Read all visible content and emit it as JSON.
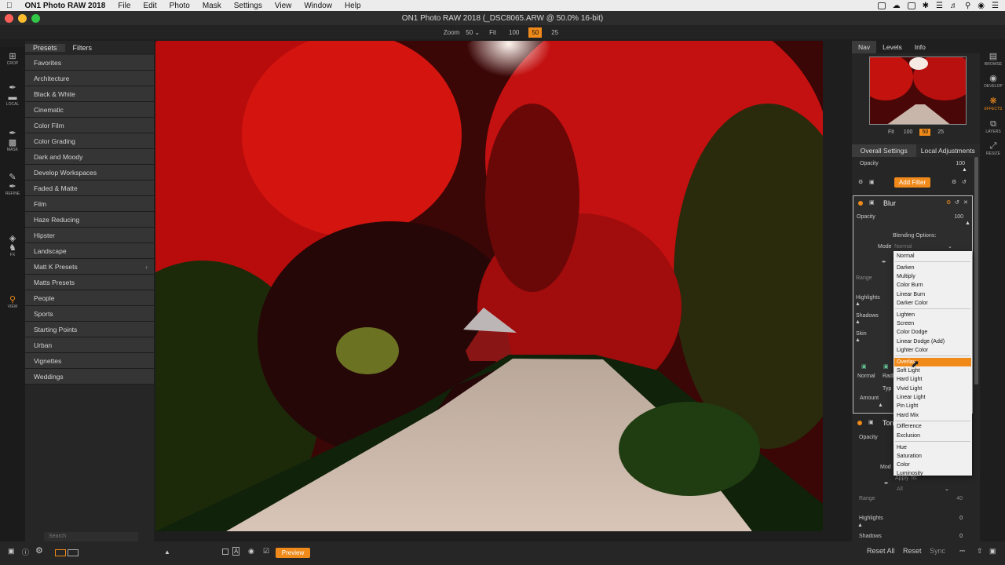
{
  "menubar": {
    "app": "ON1 Photo RAW 2018",
    "items": [
      "File",
      "Edit",
      "Photo",
      "Mask",
      "Settings",
      "View",
      "Window",
      "Help"
    ]
  },
  "window_title": "ON1 Photo RAW 2018 (_DSC8065.ARW @ 50.0% 16-bit)",
  "toolbar": {
    "zoom_label": "Zoom",
    "zoom_value": "50",
    "fit": "Fit",
    "z100": "100",
    "z50": "50",
    "z25": "25"
  },
  "left_tools": [
    "CROP",
    "LOCAL",
    "MASK",
    "REFINE",
    "FX",
    "VIEW"
  ],
  "presets": {
    "tab_presets": "Presets",
    "tab_filters": "Filters",
    "items": [
      "Favorites",
      "Architecture",
      "Black & White",
      "Cinematic",
      "Color Film",
      "Color Grading",
      "Dark and Moody",
      "Develop Workspaces",
      "Faded & Matte",
      "Film",
      "Haze Reducing",
      "Hipster",
      "Landscape",
      "Matt K Presets",
      "Matts Presets",
      "People",
      "Sports",
      "Starting Points",
      "Urban",
      "Vignettes",
      "Weddings"
    ],
    "search_placeholder": "Search"
  },
  "nav": {
    "tabs": [
      "Nav",
      "Levels",
      "Info"
    ],
    "zoom": [
      "Fit",
      "100",
      "50",
      "25"
    ]
  },
  "settings_tabs": [
    "Overall Settings",
    "Local Adjustments"
  ],
  "overall": {
    "opacity_label": "Opacity",
    "opacity_value": "100",
    "add_filter": "Add Filter"
  },
  "blur_filter": {
    "title": "Blur",
    "opacity_label": "Opacity",
    "opacity_value": "100",
    "blending_label": "Blending Options:",
    "mode_label": "Mode",
    "mode_value": "Normal",
    "range_label": "Range",
    "highlights_label": "Highlights",
    "shadows_label": "Shadows",
    "skin_label": "Skin",
    "normal_label": "Normal",
    "radial_label": "Radi",
    "type_label": "Typ",
    "amount_label": "Amount"
  },
  "tone_filter": {
    "title": "Ton",
    "opacity_label": "Opacity",
    "mode_label": "Mod",
    "apply_label": "Apply To:",
    "apply_value": "All",
    "range_label": "Range",
    "range_value": "40",
    "highlights_label": "Highlights",
    "highlights_value": "0",
    "shadows_label": "Shadows",
    "shadows_value": "0"
  },
  "blend_modes": {
    "groups": [
      [
        "Normal"
      ],
      [
        "Darken",
        "Multiply",
        "Color Burn",
        "Linear Burn",
        "Darker Color"
      ],
      [
        "Lighten",
        "Screen",
        "Color Dodge",
        "Linear Dodge (Add)",
        "Lighter Color"
      ],
      [
        "Overlay",
        "Soft Light",
        "Hard Light",
        "Vivid Light",
        "Linear Light",
        "Pin Light",
        "Hard Mix"
      ],
      [
        "Difference",
        "Exclusion"
      ],
      [
        "Hue",
        "Saturation",
        "Color",
        "Luminosity"
      ]
    ],
    "selected": "Overlay"
  },
  "right_modules": [
    "BROWSE",
    "DEVELOP",
    "EFFECTS",
    "LAYERS",
    "RESIZE"
  ],
  "active_module": "EFFECTS",
  "bottom": {
    "preview": "Preview",
    "reset_all": "Reset All",
    "reset": "Reset",
    "sync": "Sync"
  },
  "colors": {
    "accent": "#f08a1a",
    "panel": "#262626",
    "list_row": "#353535"
  }
}
